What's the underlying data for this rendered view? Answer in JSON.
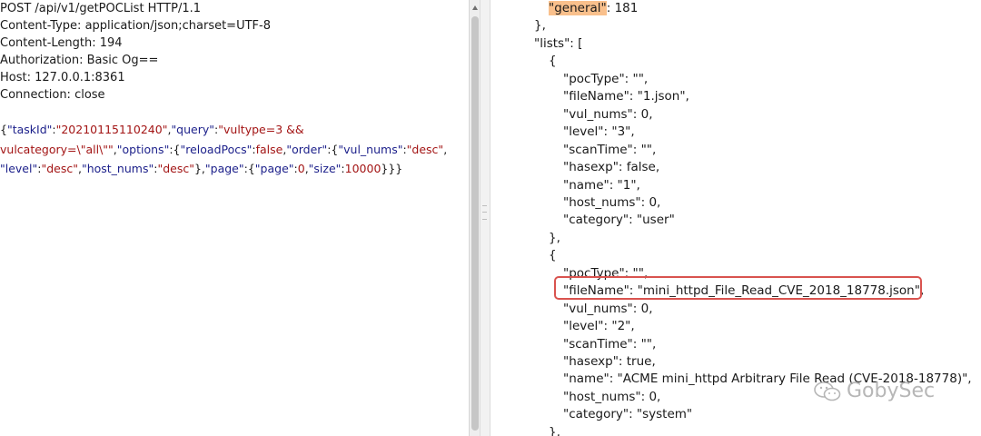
{
  "request": {
    "headers": [
      "POST /api/v1/getPOCList HTTP/1.1",
      "Content-Type: application/json;charset=UTF-8",
      "Content-Length: 194",
      "Authorization: Basic Og==",
      "Host: 127.0.0.1:8361",
      "Connection: close"
    ],
    "body": {
      "p1": "{",
      "k_taskId": "\"taskId\"",
      "p2": ":",
      "v_taskId": "\"20210115110240\"",
      "p3": ",",
      "k_query": "\"query\"",
      "p4": ":",
      "v_query_1": "\"vultype=3 &&",
      "v_query_2": "vulcategory=\\\"all\\\"\"",
      "p5": ",",
      "k_options": "\"options\"",
      "p6": ":{",
      "k_reloadPocs": "\"reloadPocs\"",
      "p7": ":",
      "v_reloadPocs": "false",
      "p8": ",",
      "k_order": "\"order\"",
      "p9": ":{",
      "k_vul_nums": "\"vul_nums\"",
      "p10": ":",
      "v_vul_nums": "\"desc\"",
      "p11": ",",
      "k_level": "\"level\"",
      "p12": ":",
      "v_level": "\"desc\"",
      "p13": ",",
      "k_host_nums": "\"host_nums\"",
      "p14": ":",
      "v_host_nums": "\"desc\"",
      "p15": "},",
      "k_page": "\"page\"",
      "p16": ":{",
      "k_page2": "\"page\"",
      "p17": ":",
      "v_page": "0",
      "p18": ",",
      "k_size": "\"size\"",
      "p19": ":",
      "v_size": "10000",
      "p20": "}}}"
    }
  },
  "response": {
    "lines": [
      {
        "text": "\"general\": 181",
        "indent": 4
      },
      {
        "text": "},",
        "indent": 3
      },
      {
        "text": "\"lists\": [",
        "indent": 3
      },
      {
        "text": "{",
        "indent": 4
      },
      {
        "text": "\"pocType\": \"\",",
        "indent": 5
      },
      {
        "text": "\"fileName\": \"1.json\",",
        "indent": 5
      },
      {
        "text": "\"vul_nums\": 0,",
        "indent": 5
      },
      {
        "text": "\"level\": \"3\",",
        "indent": 5
      },
      {
        "text": "\"scanTime\": \"\",",
        "indent": 5
      },
      {
        "text": "\"hasexp\": false,",
        "indent": 5
      },
      {
        "text": "\"name\": \"1\",",
        "indent": 5
      },
      {
        "text": "\"host_nums\": 0,",
        "indent": 5
      },
      {
        "text": "\"category\": \"user\"",
        "indent": 5
      },
      {
        "text": "},",
        "indent": 4
      },
      {
        "text": "{",
        "indent": 4
      },
      {
        "text": "\"pocType\": \"\",",
        "indent": 5
      },
      {
        "text": "\"fileName\": \"mini_httpd_File_Read_CVE_2018_18778.json\",",
        "indent": 5
      },
      {
        "text": "\"vul_nums\": 0,",
        "indent": 5
      },
      {
        "text": "\"level\": \"2\",",
        "indent": 5
      },
      {
        "text": "\"scanTime\": \"\",",
        "indent": 5
      },
      {
        "text": "\"hasexp\": true,",
        "indent": 5
      },
      {
        "text": "\"name\": \"ACME mini_httpd Arbitrary File Read (CVE-2018-18778)\",",
        "indent": 5
      },
      {
        "text": "\"host_nums\": 0,",
        "indent": 5
      },
      {
        "text": "\"category\": \"system\"",
        "indent": 5
      },
      {
        "text": "},",
        "indent": 4
      }
    ],
    "general_key": "\"general\"",
    "general_value": ": 181"
  },
  "watermark": "GobySec",
  "colors": {
    "key": "#1b1f8a",
    "string": "#a31515",
    "highlight": "#f9c08c",
    "annotation_box": "#d9534f"
  }
}
